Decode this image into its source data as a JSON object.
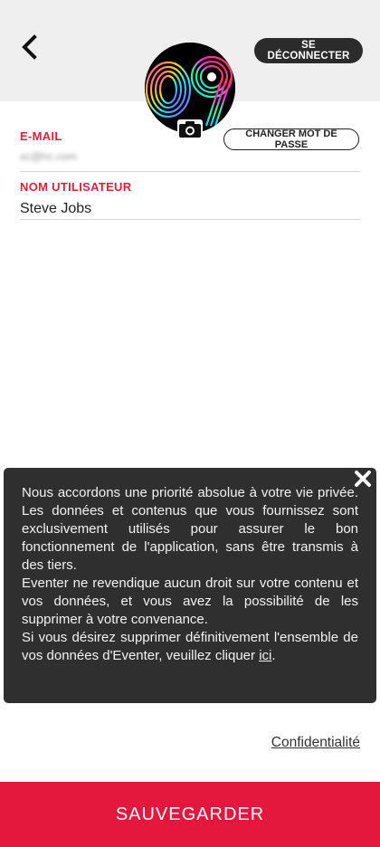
{
  "header": {
    "logout_label": "SE DÉCONNECTER",
    "back_icon": "chevron-left-icon"
  },
  "profile": {
    "avatar_icon": "neon-09-avatar",
    "camera_icon": "camera-icon",
    "change_password_label": "CHANGER MOT DE PASSE"
  },
  "form": {
    "email_label": "E-MAIL",
    "email_value": "sc@hc.com",
    "username_label": "NOM UTILISATEUR",
    "username_value": "Steve Jobs"
  },
  "privacy_popup": {
    "paragraph_1": "Nous accordons une priorité absolue à votre vie privée. Les données et contenus que vous fournissez sont exclusivement utilisés pour assurer le bon fonctionnement de l'application, sans être transmis à des tiers.",
    "paragraph_2": "Eventer ne revendique aucun droit sur votre contenu et vos données, et vous avez la possibilité de les supprimer à votre convenance.",
    "paragraph_3_before": "Si vous désirez supprimer définitivement l'ensemble de vos données d'Eventer, veuillez cliquer ",
    "paragraph_3_link": "ici",
    "paragraph_3_after": "."
  },
  "footer": {
    "confidentiality_label": "Confidentialité",
    "save_label": "SAUVEGARDER"
  },
  "colors": {
    "accent_red": "#e4173c",
    "label_red": "#e0203a",
    "dark_button": "#2b2b2b",
    "popup_bg": "#2f2f2f"
  }
}
